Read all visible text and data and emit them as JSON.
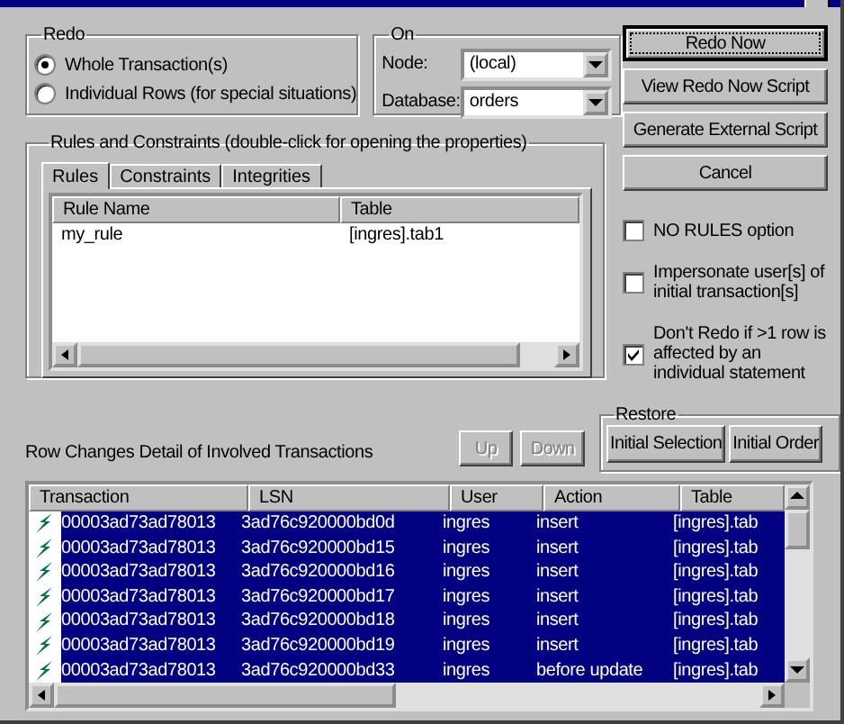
{
  "redo_group": {
    "label": "Redo",
    "options": [
      {
        "label": "Whole Transaction(s)",
        "selected": true
      },
      {
        "label": "Individual Rows (for special situations)",
        "selected": false
      }
    ]
  },
  "on_group": {
    "label": "On",
    "fields": [
      {
        "label": "Node:",
        "value": "(local)"
      },
      {
        "label": "Database:",
        "value": "orders"
      }
    ]
  },
  "rules_group": {
    "label": "Rules and Constraints (double-click for opening the properties)",
    "tabs": [
      {
        "label": "Rules",
        "selected": true
      },
      {
        "label": "Constraints",
        "selected": false
      },
      {
        "label": "Integrities",
        "selected": false
      }
    ],
    "columns": [
      "Rule Name",
      "Table"
    ],
    "rows": [
      [
        "my_rule",
        "[ingres].tab1"
      ]
    ]
  },
  "actions": [
    {
      "label": "Redo Now",
      "focused": true
    },
    {
      "label": "View Redo Now Script",
      "focused": false
    },
    {
      "label": "Generate External Script",
      "focused": false
    },
    {
      "label": "Cancel",
      "focused": false
    }
  ],
  "options": [
    {
      "label": "NO RULES option",
      "checked": false
    },
    {
      "label": "Impersonate user[s] of initial transaction[s]",
      "checked": false
    },
    {
      "label": "Don't Redo if >1 row is affected by an individual statement",
      "checked": true
    }
  ],
  "detail_label": "Row Changes Detail of Involved Transactions",
  "move_buttons": [
    {
      "label": "Up",
      "disabled": true
    },
    {
      "label": "Down",
      "disabled": true
    }
  ],
  "restore_group": {
    "label": "Restore",
    "buttons": [
      "Initial Selection",
      "Initial Order"
    ]
  },
  "transactions": {
    "columns": [
      "Transaction",
      "LSN",
      "User",
      "Action",
      "Table"
    ],
    "rows": [
      {
        "cells": [
          "00003ad73ad78013",
          "3ad76c920000bd0d",
          "ingres",
          "insert",
          "[ingres].tab"
        ],
        "selected": true
      },
      {
        "cells": [
          "00003ad73ad78013",
          "3ad76c920000bd15",
          "ingres",
          "insert",
          "[ingres].tab"
        ],
        "selected": true
      },
      {
        "cells": [
          "00003ad73ad78013",
          "3ad76c920000bd16",
          "ingres",
          "insert",
          "[ingres].tab"
        ],
        "selected": true
      },
      {
        "cells": [
          "00003ad73ad78013",
          "3ad76c920000bd17",
          "ingres",
          "insert",
          "[ingres].tab"
        ],
        "selected": true
      },
      {
        "cells": [
          "00003ad73ad78013",
          "3ad76c920000bd18",
          "ingres",
          "insert",
          "[ingres].tab"
        ],
        "selected": true
      },
      {
        "cells": [
          "00003ad73ad78013",
          "3ad76c920000bd19",
          "ingres",
          "insert",
          "[ingres].tab"
        ],
        "selected": true
      },
      {
        "cells": [
          "00003ad73ad78013",
          "3ad76c920000bd33",
          "ingres",
          "before update",
          "[ingres].tab"
        ],
        "selected": true
      }
    ]
  }
}
